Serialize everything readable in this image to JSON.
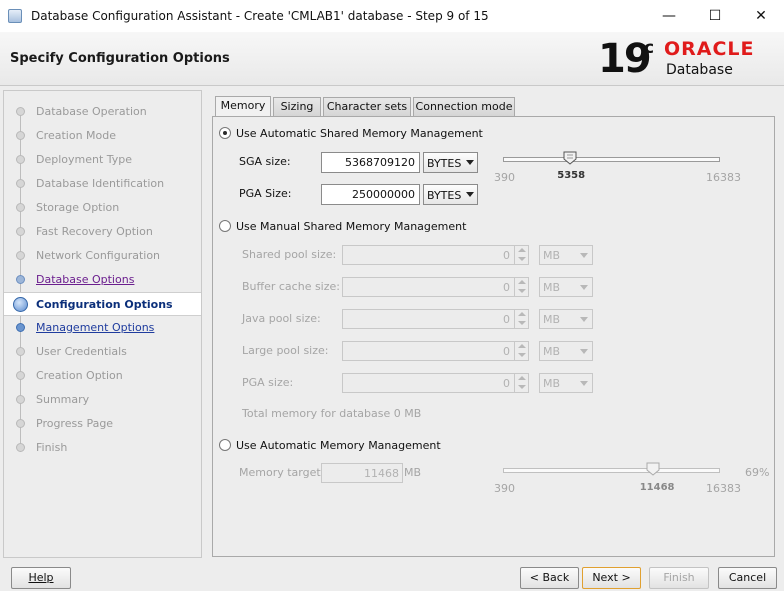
{
  "window": {
    "title": "Database Configuration Assistant - Create 'CMLAB1' database - Step 9 of 15",
    "controls": {
      "minimize": "—",
      "maximize": "☐",
      "close": "✕"
    }
  },
  "header": {
    "page_title": "Specify Configuration Options",
    "version": "19",
    "version_suffix": "c",
    "brand": "ORACLE",
    "product": "Database"
  },
  "steps": [
    {
      "label": "Database Operation",
      "state": "done"
    },
    {
      "label": "Creation Mode",
      "state": "done"
    },
    {
      "label": "Deployment Type",
      "state": "done"
    },
    {
      "label": "Database Identification",
      "state": "done"
    },
    {
      "label": "Storage Option",
      "state": "done"
    },
    {
      "label": "Fast Recovery Option",
      "state": "done"
    },
    {
      "label": "Network Configuration",
      "state": "done"
    },
    {
      "label": "Database Options",
      "state": "visited"
    },
    {
      "label": "Configuration Options",
      "state": "current"
    },
    {
      "label": "Management Options",
      "state": "link"
    },
    {
      "label": "User Credentials",
      "state": "pending"
    },
    {
      "label": "Creation Option",
      "state": "pending"
    },
    {
      "label": "Summary",
      "state": "pending"
    },
    {
      "label": "Progress Page",
      "state": "pending"
    },
    {
      "label": "Finish",
      "state": "pending"
    }
  ],
  "tabs": [
    {
      "label": "Memory",
      "active": true
    },
    {
      "label": "Sizing",
      "active": false
    },
    {
      "label": "Character sets",
      "active": false
    },
    {
      "label": "Connection mode",
      "active": false
    }
  ],
  "memory": {
    "asmm": {
      "label": "Use Automatic Shared Memory Management",
      "selected": true,
      "sga_label": "SGA size:",
      "sga_value": "5368709120",
      "sga_unit": "BYTES",
      "pga_label": "PGA Size:",
      "pga_value": "250000000",
      "pga_unit": "BYTES",
      "slider": {
        "min": "390",
        "max": "16383",
        "value": "5358",
        "fraction": 0.31
      }
    },
    "manual": {
      "label": "Use Manual Shared Memory Management",
      "selected": false,
      "fields": [
        {
          "label": "Shared pool size:",
          "value": "0",
          "unit": "MB"
        },
        {
          "label": "Buffer cache size:",
          "value": "0",
          "unit": "MB"
        },
        {
          "label": "Java pool size:",
          "value": "0",
          "unit": "MB"
        },
        {
          "label": "Large pool size:",
          "value": "0",
          "unit": "MB"
        },
        {
          "label": "PGA size:",
          "value": "0",
          "unit": "MB"
        }
      ],
      "total": "Total memory for database 0 MB"
    },
    "amm": {
      "label": "Use Automatic Memory Management",
      "selected": false,
      "target_label": "Memory target:",
      "target_value": "11468",
      "target_unit": "MB",
      "percent": "69%",
      "slider": {
        "min": "390",
        "max": "16383",
        "value": "11468",
        "fraction": 0.69
      }
    }
  },
  "buttons": {
    "help": "Help",
    "back": "< Back",
    "next": "Next >",
    "finish": "Finish",
    "cancel": "Cancel"
  },
  "colors": {
    "oracle_red": "#e01b1b",
    "current_step": "#0b2f7a",
    "visited_step": "#6b1e8e",
    "link_step": "#1f3c9e"
  }
}
